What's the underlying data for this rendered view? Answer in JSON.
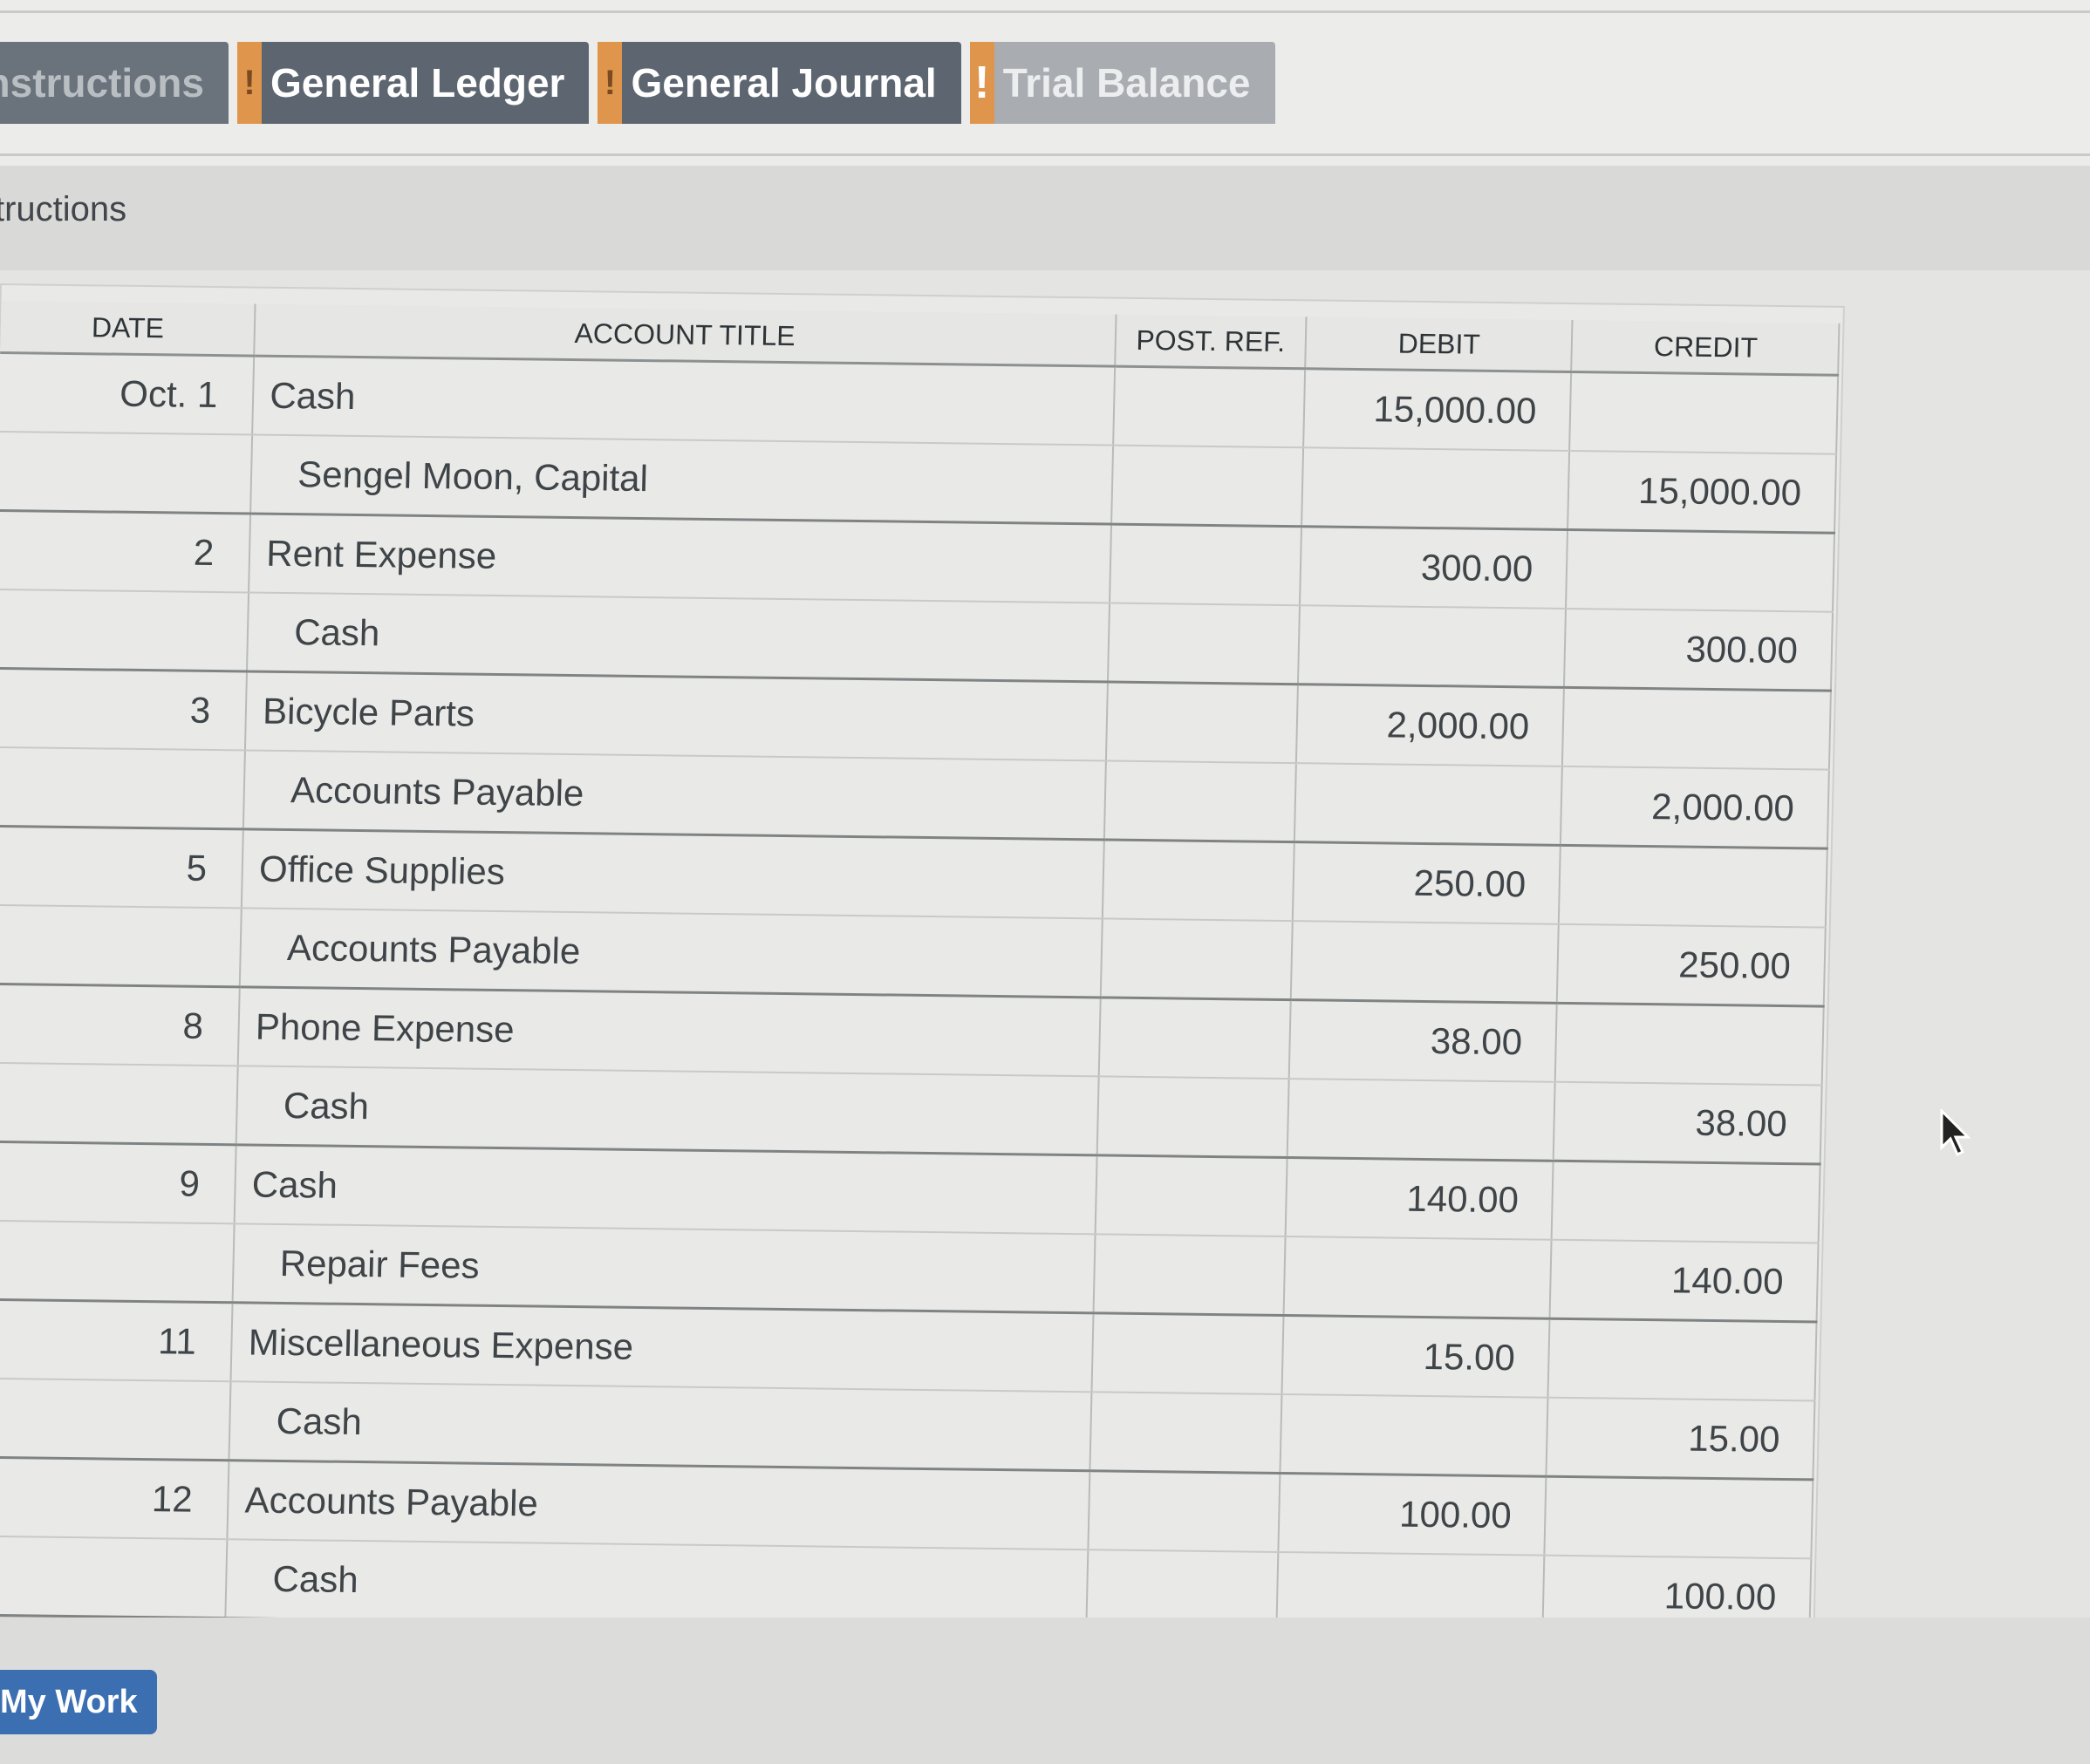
{
  "tabs": [
    {
      "label": "nstructions",
      "flag": ""
    },
    {
      "label": "General Ledger",
      "flag": "!"
    },
    {
      "label": "General Journal",
      "flag": "!"
    },
    {
      "label": "Trial Balance",
      "flag": "!"
    }
  ],
  "section_title": "tructions",
  "journal": {
    "headers": {
      "date": "DATE",
      "account_title": "ACCOUNT TITLE",
      "post_ref": "POST. REF.",
      "debit": "DEBIT",
      "credit": "CREDIT"
    },
    "rows": [
      {
        "date": "Oct. 1",
        "title": "Cash",
        "post_ref": "",
        "debit": "15,000.00",
        "credit": ""
      },
      {
        "date": "",
        "title": "Sengel Moon, Capital",
        "post_ref": "",
        "debit": "",
        "credit": "15,000.00"
      },
      {
        "date": "2",
        "title": "Rent Expense",
        "post_ref": "",
        "debit": "300.00",
        "credit": ""
      },
      {
        "date": "",
        "title": "Cash",
        "post_ref": "",
        "debit": "",
        "credit": "300.00"
      },
      {
        "date": "3",
        "title": "Bicycle Parts",
        "post_ref": "",
        "debit": "2,000.00",
        "credit": ""
      },
      {
        "date": "",
        "title": "Accounts Payable",
        "post_ref": "",
        "debit": "",
        "credit": "2,000.00"
      },
      {
        "date": "5",
        "title": "Office Supplies",
        "post_ref": "",
        "debit": "250.00",
        "credit": ""
      },
      {
        "date": "",
        "title": "Accounts Payable",
        "post_ref": "",
        "debit": "",
        "credit": "250.00"
      },
      {
        "date": "8",
        "title": "Phone Expense",
        "post_ref": "",
        "debit": "38.00",
        "credit": ""
      },
      {
        "date": "",
        "title": "Cash",
        "post_ref": "",
        "debit": "",
        "credit": "38.00"
      },
      {
        "date": "9",
        "title": "Cash",
        "post_ref": "",
        "debit": "140.00",
        "credit": ""
      },
      {
        "date": "",
        "title": "Repair Fees",
        "post_ref": "",
        "debit": "",
        "credit": "140.00"
      },
      {
        "date": "11",
        "title": "Miscellaneous Expense",
        "post_ref": "",
        "debit": "15.00",
        "credit": ""
      },
      {
        "date": "",
        "title": "Cash",
        "post_ref": "",
        "debit": "",
        "credit": "15.00"
      },
      {
        "date": "12",
        "title": "Accounts Payable",
        "post_ref": "",
        "debit": "100.00",
        "credit": ""
      },
      {
        "date": "",
        "title": "Cash",
        "post_ref": "",
        "debit": "",
        "credit": "100.00"
      }
    ]
  },
  "my_work_button": "My Work",
  "colors": {
    "tab_bg": "#5d6670",
    "tab_disabled_bg": "#a9adb1",
    "warning_flag": "#e0954d",
    "button_blue": "#3b6fb2"
  }
}
